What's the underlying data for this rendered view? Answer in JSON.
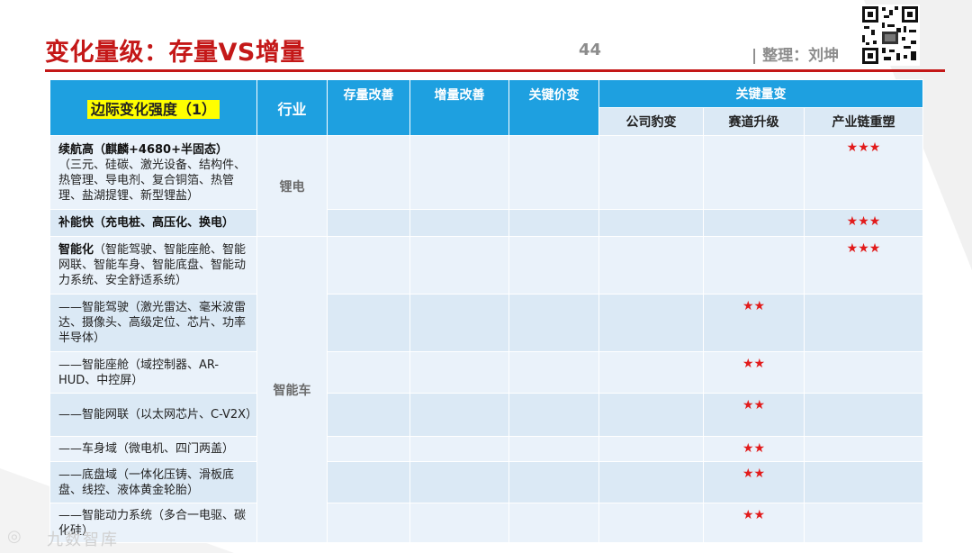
{
  "header": {
    "title": "变化量级：存量VS增量",
    "page_number": "44",
    "author": "| 整理：刘坤"
  },
  "table": {
    "headers": {
      "col1": "边际变化强度（1）",
      "industry": "行业",
      "stock": "存量改善",
      "incremental": "增量改善",
      "key_price": "关键价变",
      "key_volume": "关键量变",
      "sub_company": "公司豹变",
      "sub_track": "赛道升级",
      "sub_chain": "产业链重塑"
    },
    "industries": {
      "battery": "锂电",
      "smart_car": "智能车"
    },
    "rows": [
      {
        "lead": "续航高（麒麟+4680+半固态）",
        "detail": "（三元、硅碳、激光设备、结构件、热管理、导电剂、复合铜箔、热管理、盐湖提锂、新型锂盐）",
        "track": "",
        "chain": "★★★"
      },
      {
        "lead": "补能快（充电桩、高压化、换电）",
        "detail": "",
        "track": "",
        "chain": "★★★"
      },
      {
        "lead": "智能化",
        "detail": "（智能驾驶、智能座舱、智能网联、智能车身、智能底盘、智能动力系统、安全舒适系统）",
        "track": "",
        "chain": "★★★"
      },
      {
        "lead": "",
        "detail": "——智能驾驶（激光雷达、毫米波雷达、摄像头、高级定位、芯片、功率半导体）",
        "track": "★★",
        "chain": ""
      },
      {
        "lead": "",
        "detail": "——智能座舱（域控制器、AR-HUD、中控屏）",
        "track": "★★",
        "chain": ""
      },
      {
        "lead": "",
        "detail": "——智能网联（以太网芯片、C-V2X）",
        "track": "★★",
        "chain": ""
      },
      {
        "lead": "",
        "detail": "——车身域（微电机、四门两盖）",
        "track": "★★",
        "chain": ""
      },
      {
        "lead": "",
        "detail": "——底盘域（一体化压铸、滑板底盘、线控、液体黄金轮胎）",
        "track": "★★",
        "chain": ""
      },
      {
        "lead": "",
        "detail": "——智能动力系统（多合一电驱、碳化硅）",
        "track": "★★",
        "chain": ""
      }
    ]
  },
  "footer": {
    "watermark": "九数智库"
  },
  "colors": {
    "title_red": "#c41818",
    "header_blue": "#1ea0e0",
    "star_red": "#e21b1b",
    "highlight_yellow": "#ffff00"
  }
}
